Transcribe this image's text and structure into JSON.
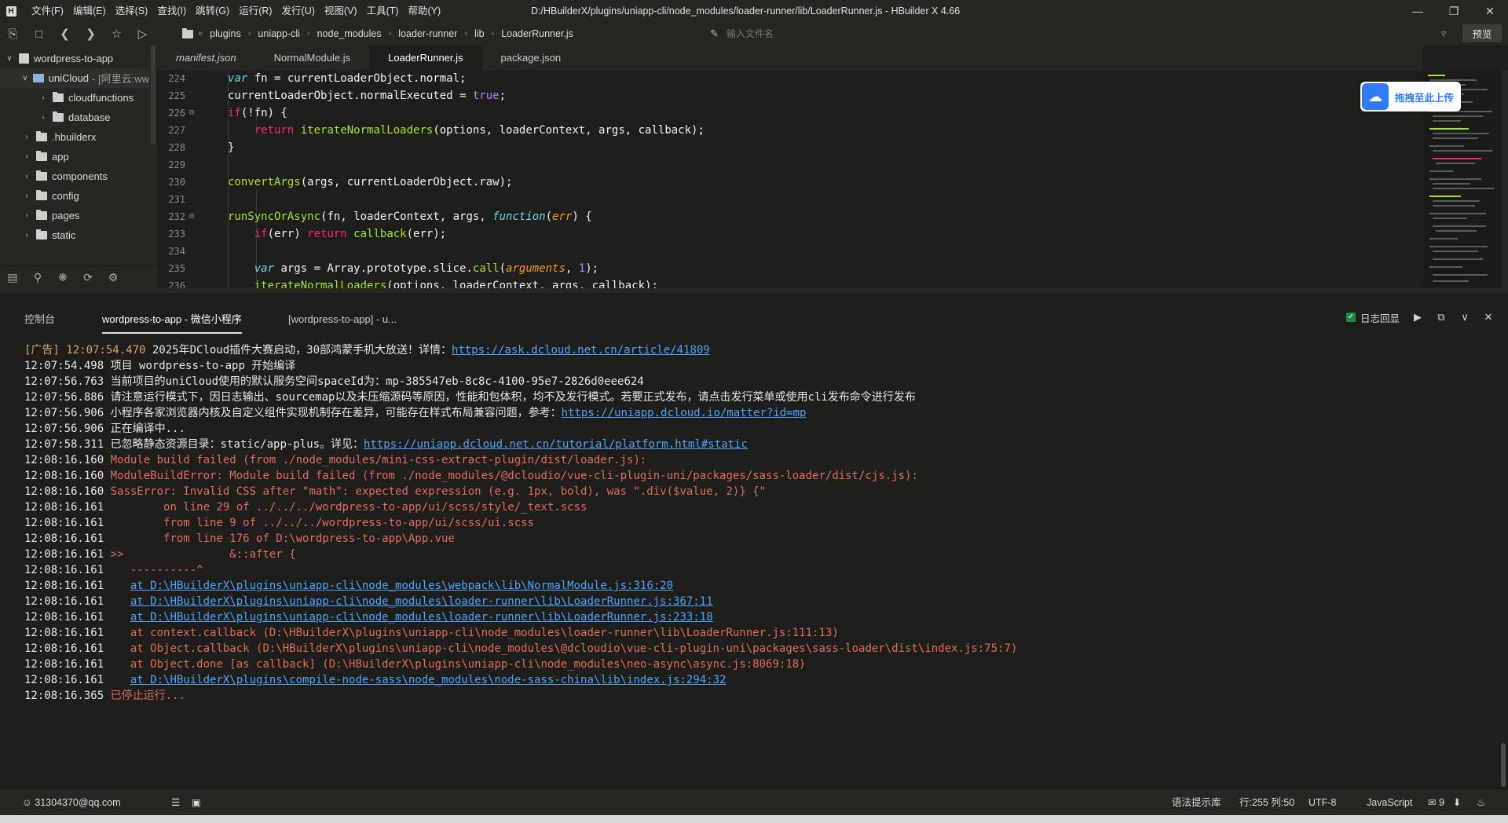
{
  "app": {
    "logo_letter": "H",
    "window_title": "D:/HBuilderX/plugins/uniapp-cli/node_modules/loader-runner/lib/LoaderRunner.js - HBuilder X 4.66",
    "menu": [
      "文件(F)",
      "编辑(E)",
      "选择(S)",
      "查找(I)",
      "跳转(G)",
      "运行(R)",
      "发行(U)",
      "视图(V)",
      "工具(T)",
      "帮助(Y)"
    ]
  },
  "toolbar": {
    "breadcrumb": [
      "plugins",
      "uniapp-cli",
      "node_modules",
      "loader-runner",
      "lib",
      "LoaderRunner.js"
    ],
    "search_placeholder": "输入文件名",
    "preview_label": "预览"
  },
  "sidebar": {
    "project": "wordpress-to-app",
    "unicloud": "uniCloud",
    "unicloud_suffix": "- [阿里云:ww",
    "items": [
      "cloudfunctions",
      "database",
      ".hbuilderx",
      "app",
      "components",
      "config",
      "pages",
      "static"
    ]
  },
  "editor": {
    "tabs": [
      "manifest.json",
      "NormalModule.js",
      "LoaderRunner.js",
      "package.json"
    ],
    "active_tab": "LoaderRunner.js",
    "line_numbers": [
      "224",
      "225",
      "226",
      "227",
      "228",
      "229",
      "230",
      "231",
      "232",
      "233",
      "234",
      "235",
      "236"
    ]
  },
  "upload_widget": {
    "label": "拖拽至此上传"
  },
  "panel": {
    "tabs": [
      "控制台",
      "wordpress-to-app - 微信小程序",
      "[wordpress-to-app] - u..."
    ],
    "log_replay_label": "日志回显"
  },
  "console": {
    "lines": [
      {
        "ts": "[广告] 12:07:54.470",
        "text": " 2025年DCloud插件大赛启动，30部鸿蒙手机大放送！详情：",
        "link": "https://ask.dcloud.net.cn/article/41809"
      },
      {
        "ts": "12:07:54.498",
        "text": " 项目 wordpress-to-app 开始编译"
      },
      {
        "ts": "12:07:56.763",
        "text": " 当前项目的uniCloud使用的默认服务空间spaceId为：mp-385547eb-8c8c-4100-95e7-2826d0eee624"
      },
      {
        "ts": "12:07:56.886",
        "text": " 请注意运行模式下，因日志输出、sourcemap以及未压缩源码等原因，性能和包体积，均不及发行模式。若要正式发布，请点击发行菜单或使用cli发布命令进行发布"
      },
      {
        "ts": "12:07:56.906",
        "text": " 小程序各家浏览器内核及自定义组件实现机制存在差异，可能存在样式布局兼容问题，参考：",
        "link": "https://uniapp.dcloud.io/matter?id=mp"
      },
      {
        "ts": "12:07:56.906",
        "text": " 正在编译中..."
      },
      {
        "ts": "12:07:58.311",
        "text": " 已忽略静态资源目录：static/app-plus。详见：",
        "link": "https://uniapp.dcloud.net.cn/tutorial/platform.html#static"
      },
      {
        "ts": "12:08:16.160",
        "text": " Module build failed (from ./node_modules/mini-css-extract-plugin/dist/loader.js):",
        "err": true
      },
      {
        "ts": "12:08:16.160",
        "text": " ModuleBuildError: Module build failed (from ./node_modules/@dcloudio/vue-cli-plugin-uni/packages/sass-loader/dist/cjs.js):",
        "err": true
      },
      {
        "ts": "12:08:16.160",
        "text": " SassError: Invalid CSS after \"math\": expected expression (e.g. 1px, bold), was \".div($value, 2)} {\"",
        "err": true
      },
      {
        "ts": "12:08:16.161",
        "text": "         on line 29 of ../../../wordpress-to-app/ui/scss/style/_text.scss",
        "err": true
      },
      {
        "ts": "12:08:16.161",
        "text": "         from line 9 of ../../../wordpress-to-app/ui/scss/ui.scss",
        "err": true
      },
      {
        "ts": "12:08:16.161",
        "text": "         from line 176 of D:\\wordpress-to-app\\App.vue",
        "err": true
      },
      {
        "ts": "12:08:16.161",
        "text": " >>                &::after {",
        "err": true
      },
      {
        "ts": "12:08:16.161",
        "text": "    ----------^",
        "err": true
      },
      {
        "ts": "12:08:16.161",
        "text": "    ",
        "link": "at D:\\HBuilderX\\plugins\\uniapp-cli\\node_modules\\webpack\\lib\\NormalModule.js:316:20"
      },
      {
        "ts": "12:08:16.161",
        "text": "    ",
        "link": "at D:\\HBuilderX\\plugins\\uniapp-cli\\node_modules\\loader-runner\\lib\\LoaderRunner.js:367:11"
      },
      {
        "ts": "12:08:16.161",
        "text": "    ",
        "link": "at D:\\HBuilderX\\plugins\\uniapp-cli\\node_modules\\loader-runner\\lib\\LoaderRunner.js:233:18"
      },
      {
        "ts": "12:08:16.161",
        "text": "    at context.callback (D:\\HBuilderX\\plugins\\uniapp-cli\\node_modules\\loader-runner\\lib\\LoaderRunner.js:111:13)",
        "err": true
      },
      {
        "ts": "12:08:16.161",
        "text": "    at Object.callback (D:\\HBuilderX\\plugins\\uniapp-cli\\node_modules\\@dcloudio\\vue-cli-plugin-uni\\packages\\sass-loader\\dist\\index.js:75:7)",
        "err": true
      },
      {
        "ts": "12:08:16.161",
        "text": "    at Object.done [as callback] (D:\\HBuilderX\\plugins\\uniapp-cli\\node_modules\\neo-async\\async.js:8069:18)",
        "err": true
      },
      {
        "ts": "12:08:16.161",
        "text": "    ",
        "link": "at D:\\HBuilderX\\plugins\\compile-node-sass\\node_modules\\node-sass-china\\lib\\index.js:294:32"
      },
      {
        "ts": "12:08:16.365",
        "text": " 已停止运行...",
        "err": true
      }
    ]
  },
  "statusbar": {
    "account": "31304370@qq.com",
    "syntax_hint": "语法提示库",
    "position": "行:255  列:50",
    "encoding": "UTF-8",
    "language": "JavaScript",
    "notifications": "9"
  }
}
